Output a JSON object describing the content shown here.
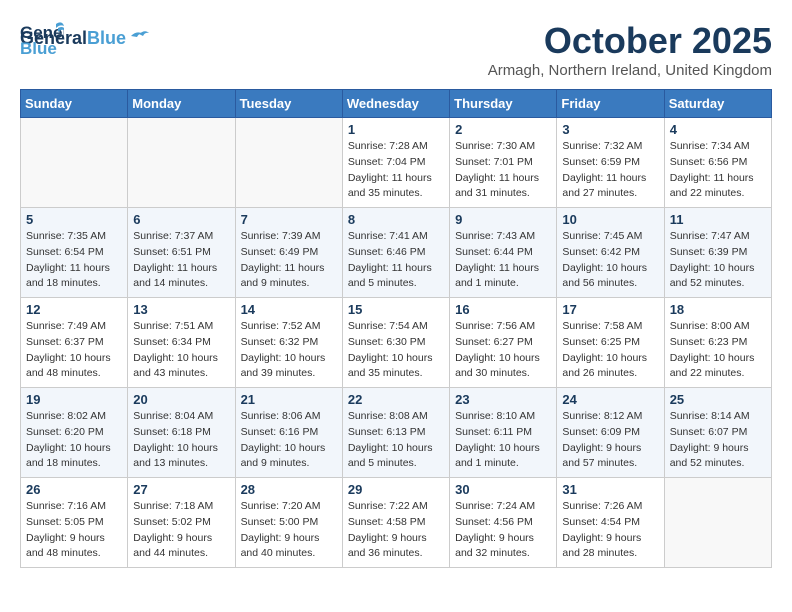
{
  "logo": {
    "line1": "General",
    "line2": "Blue"
  },
  "title": "October 2025",
  "subtitle": "Armagh, Northern Ireland, United Kingdom",
  "days_of_week": [
    "Sunday",
    "Monday",
    "Tuesday",
    "Wednesday",
    "Thursday",
    "Friday",
    "Saturday"
  ],
  "weeks": [
    [
      {
        "num": "",
        "info": ""
      },
      {
        "num": "",
        "info": ""
      },
      {
        "num": "",
        "info": ""
      },
      {
        "num": "1",
        "info": "Sunrise: 7:28 AM\nSunset: 7:04 PM\nDaylight: 11 hours\nand 35 minutes."
      },
      {
        "num": "2",
        "info": "Sunrise: 7:30 AM\nSunset: 7:01 PM\nDaylight: 11 hours\nand 31 minutes."
      },
      {
        "num": "3",
        "info": "Sunrise: 7:32 AM\nSunset: 6:59 PM\nDaylight: 11 hours\nand 27 minutes."
      },
      {
        "num": "4",
        "info": "Sunrise: 7:34 AM\nSunset: 6:56 PM\nDaylight: 11 hours\nand 22 minutes."
      }
    ],
    [
      {
        "num": "5",
        "info": "Sunrise: 7:35 AM\nSunset: 6:54 PM\nDaylight: 11 hours\nand 18 minutes."
      },
      {
        "num": "6",
        "info": "Sunrise: 7:37 AM\nSunset: 6:51 PM\nDaylight: 11 hours\nand 14 minutes."
      },
      {
        "num": "7",
        "info": "Sunrise: 7:39 AM\nSunset: 6:49 PM\nDaylight: 11 hours\nand 9 minutes."
      },
      {
        "num": "8",
        "info": "Sunrise: 7:41 AM\nSunset: 6:46 PM\nDaylight: 11 hours\nand 5 minutes."
      },
      {
        "num": "9",
        "info": "Sunrise: 7:43 AM\nSunset: 6:44 PM\nDaylight: 11 hours\nand 1 minute."
      },
      {
        "num": "10",
        "info": "Sunrise: 7:45 AM\nSunset: 6:42 PM\nDaylight: 10 hours\nand 56 minutes."
      },
      {
        "num": "11",
        "info": "Sunrise: 7:47 AM\nSunset: 6:39 PM\nDaylight: 10 hours\nand 52 minutes."
      }
    ],
    [
      {
        "num": "12",
        "info": "Sunrise: 7:49 AM\nSunset: 6:37 PM\nDaylight: 10 hours\nand 48 minutes."
      },
      {
        "num": "13",
        "info": "Sunrise: 7:51 AM\nSunset: 6:34 PM\nDaylight: 10 hours\nand 43 minutes."
      },
      {
        "num": "14",
        "info": "Sunrise: 7:52 AM\nSunset: 6:32 PM\nDaylight: 10 hours\nand 39 minutes."
      },
      {
        "num": "15",
        "info": "Sunrise: 7:54 AM\nSunset: 6:30 PM\nDaylight: 10 hours\nand 35 minutes."
      },
      {
        "num": "16",
        "info": "Sunrise: 7:56 AM\nSunset: 6:27 PM\nDaylight: 10 hours\nand 30 minutes."
      },
      {
        "num": "17",
        "info": "Sunrise: 7:58 AM\nSunset: 6:25 PM\nDaylight: 10 hours\nand 26 minutes."
      },
      {
        "num": "18",
        "info": "Sunrise: 8:00 AM\nSunset: 6:23 PM\nDaylight: 10 hours\nand 22 minutes."
      }
    ],
    [
      {
        "num": "19",
        "info": "Sunrise: 8:02 AM\nSunset: 6:20 PM\nDaylight: 10 hours\nand 18 minutes."
      },
      {
        "num": "20",
        "info": "Sunrise: 8:04 AM\nSunset: 6:18 PM\nDaylight: 10 hours\nand 13 minutes."
      },
      {
        "num": "21",
        "info": "Sunrise: 8:06 AM\nSunset: 6:16 PM\nDaylight: 10 hours\nand 9 minutes."
      },
      {
        "num": "22",
        "info": "Sunrise: 8:08 AM\nSunset: 6:13 PM\nDaylight: 10 hours\nand 5 minutes."
      },
      {
        "num": "23",
        "info": "Sunrise: 8:10 AM\nSunset: 6:11 PM\nDaylight: 10 hours\nand 1 minute."
      },
      {
        "num": "24",
        "info": "Sunrise: 8:12 AM\nSunset: 6:09 PM\nDaylight: 9 hours\nand 57 minutes."
      },
      {
        "num": "25",
        "info": "Sunrise: 8:14 AM\nSunset: 6:07 PM\nDaylight: 9 hours\nand 52 minutes."
      }
    ],
    [
      {
        "num": "26",
        "info": "Sunrise: 7:16 AM\nSunset: 5:05 PM\nDaylight: 9 hours\nand 48 minutes."
      },
      {
        "num": "27",
        "info": "Sunrise: 7:18 AM\nSunset: 5:02 PM\nDaylight: 9 hours\nand 44 minutes."
      },
      {
        "num": "28",
        "info": "Sunrise: 7:20 AM\nSunset: 5:00 PM\nDaylight: 9 hours\nand 40 minutes."
      },
      {
        "num": "29",
        "info": "Sunrise: 7:22 AM\nSunset: 4:58 PM\nDaylight: 9 hours\nand 36 minutes."
      },
      {
        "num": "30",
        "info": "Sunrise: 7:24 AM\nSunset: 4:56 PM\nDaylight: 9 hours\nand 32 minutes."
      },
      {
        "num": "31",
        "info": "Sunrise: 7:26 AM\nSunset: 4:54 PM\nDaylight: 9 hours\nand 28 minutes."
      },
      {
        "num": "",
        "info": ""
      }
    ]
  ]
}
